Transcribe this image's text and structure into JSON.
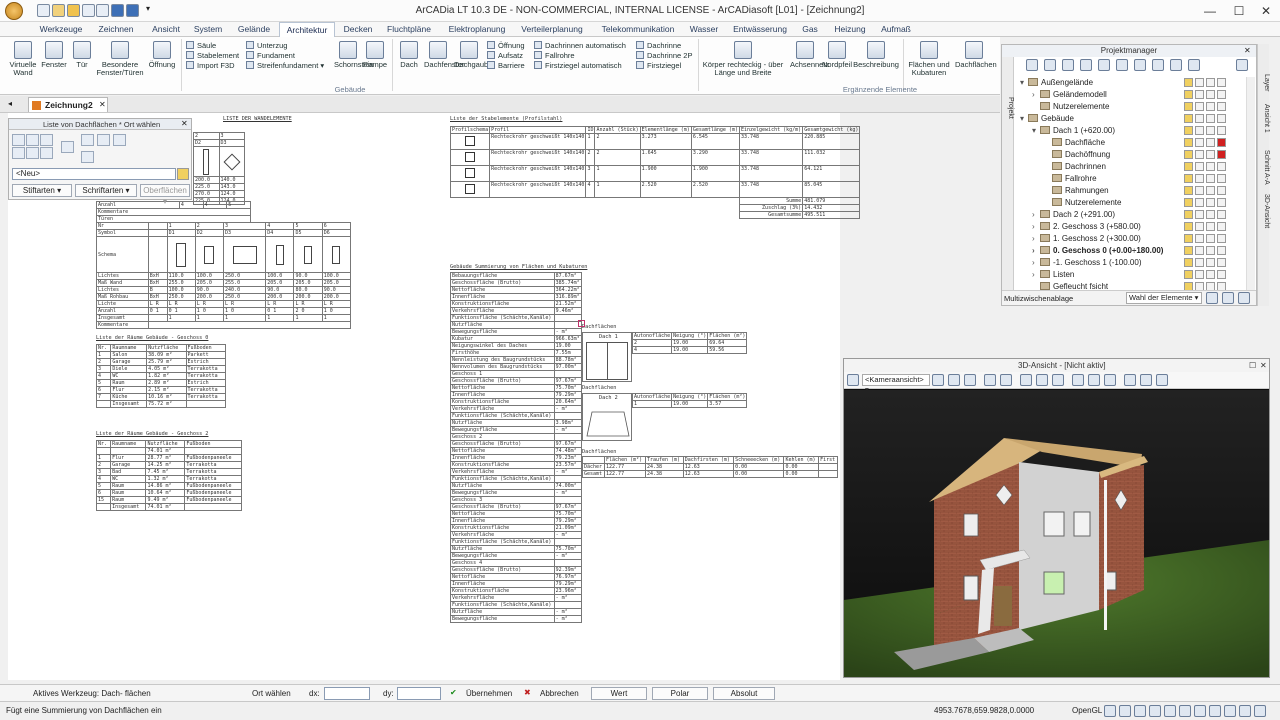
{
  "app": {
    "title": "ArCADia LT 10.3 DE - NON-COMMERCIAL, INTERNAL LICENSE - ArCADiasoft [L01] - [Zeichnung2]"
  },
  "menu": {
    "tabs": [
      "Werkzeuge",
      "Zeichnen",
      "Ansicht",
      "System",
      "Gelände",
      "Architektur",
      "Decken",
      "Fluchtpläne",
      "Elektroplanung",
      "Verteilerplanung",
      "Telekommunikation",
      "Wasser",
      "Entwässerung",
      "Gas",
      "Heizung",
      "Aufmaß"
    ],
    "active": "Architektur"
  },
  "ribbon": {
    "big1": [
      "Virtuelle Wand",
      "Fenster",
      "Tür",
      "Besondere Fenster/Türen",
      "Öffnung"
    ],
    "small1": [
      "Säule",
      "Stabelement",
      "Import F3D"
    ],
    "small2": [
      "Unterzug",
      "Fundament",
      "Streifenfundament"
    ],
    "big2": [
      "Schornstein",
      "Rampe",
      "Dach",
      "Dachfenster",
      "Dachgaube"
    ],
    "small3": [
      "Öffnung",
      "Aufsatz",
      "Barriere"
    ],
    "small4": [
      "Dachrinnen automatisch",
      "Fallrohre",
      "Firstziegel automatisch"
    ],
    "small5": [
      "Dachrinne",
      "Dachrinne 2P",
      "Firstziegel"
    ],
    "big3": [
      "Körper rechteckig - über Länge und Breite",
      "Achsennetz",
      "Nordpfeil",
      "Beschreibung",
      "Flächen und Kubaturen",
      "Dachflächen"
    ],
    "group_gebaeude": "Gebäude",
    "group_ergaenzende": "Ergänzende Elemente"
  },
  "doc": {
    "tab": "Zeichnung2"
  },
  "projektmanager": {
    "title": "Projektmanager",
    "side_left": "Projekt",
    "tree": [
      {
        "label": "Außengelände",
        "expand": "▾",
        "indent": 0
      },
      {
        "label": "Geländemodell",
        "expand": "›",
        "indent": 1
      },
      {
        "label": "Nutzerelemente",
        "expand": "",
        "indent": 1
      },
      {
        "label": "Gebäude",
        "expand": "▾",
        "indent": 0
      },
      {
        "label": "Dach 1 (+620.00)",
        "expand": "▾",
        "indent": 1
      },
      {
        "label": "Dachfläche",
        "expand": "",
        "indent": 2
      },
      {
        "label": "Dachöffnung",
        "expand": "",
        "indent": 2
      },
      {
        "label": "Dachrinnen",
        "expand": "",
        "indent": 2
      },
      {
        "label": "Fallrohre",
        "expand": "",
        "indent": 2
      },
      {
        "label": "Rahmungen",
        "expand": "",
        "indent": 2
      },
      {
        "label": "Nutzerelemente",
        "expand": "",
        "indent": 2
      },
      {
        "label": "Dach 2 (+291.00)",
        "expand": "›",
        "indent": 1
      },
      {
        "label": "2. Geschoss 3 (+580.00)",
        "expand": "›",
        "indent": 1
      },
      {
        "label": "1. Geschoss 2 (+300.00)",
        "expand": "›",
        "indent": 1
      },
      {
        "label": "0. Geschoss 0 (+0.00÷180.00)",
        "expand": "›",
        "indent": 1,
        "selected": true
      },
      {
        "label": "-1. Geschoss 1 (-100.00)",
        "expand": "›",
        "indent": 1
      },
      {
        "label": "Listen",
        "expand": "›",
        "indent": 1
      },
      {
        "label": "Gefleucht fsicht",
        "expand": "",
        "indent": 1
      }
    ],
    "footer_left": "Multizwischenablage",
    "footer_select": "Wahl der Elemente"
  },
  "sidetabs": [
    "Layer",
    "Ansicht 1",
    "Schnitt A-A",
    "3D-Ansicht"
  ],
  "dialog": {
    "title": "Liste von Dachflächen * Ort wählen",
    "value": "<Neu>",
    "btn1": "Stiftarten",
    "btn2": "Schriftarten",
    "btn3": "Oberflächen"
  },
  "drawing": {
    "title_wandelem": "LISTE DER WANDELEMENTE",
    "title_stabelem": "Liste der Stabelemente (Profilstahl)",
    "title_summ": "Gebäude Summierung von Flächen und Kubaturen",
    "title_raeume0": "Liste der Räume Gebäude - Geschoss 0",
    "title_raeume2": "Liste der Räume Gebäude - Geschoss 2",
    "stab_header": [
      "Profilschema",
      "Profil",
      "ID",
      "Anzahl (Stück)",
      "Elementlänge (m)",
      "Gesamtlänge (m)",
      "Einzelgewicht (kg/m)",
      "Gesamtgewicht (kg)"
    ],
    "stab_rows": [
      [
        "",
        "Rechteckrohr geschweißt 140x140",
        "1",
        "2",
        "3.273",
        "6.545",
        "33.748",
        "220.885"
      ],
      [
        "",
        "Rechteckrohr geschweißt 140x140",
        "2",
        "2",
        "1.645",
        "3.290",
        "33.748",
        "111.032"
      ],
      [
        "",
        "Rechteckrohr geschweißt 140x140",
        "3",
        "1",
        "1.900",
        "1.900",
        "33.748",
        "64.121"
      ],
      [
        "",
        "Rechteckrohr geschweißt 140x140",
        "4",
        "1",
        "2.520",
        "2.520",
        "33.748",
        "85.045"
      ]
    ],
    "stab_summe": [
      "Summe",
      "481.079"
    ],
    "stab_zuschlag": [
      "Zuschlag (3%)",
      "14.432"
    ],
    "stab_gesamt": [
      "Gesamtsumme",
      "495.511"
    ],
    "raeume0": [
      [
        "Nr.",
        "Raumname",
        "Nutzfläche",
        "Fußboden"
      ],
      [
        "1",
        "Salon",
        "38.09 m²",
        "Parkett"
      ],
      [
        "2",
        "Garage",
        "25.79 m²",
        "Estrich"
      ],
      [
        "3",
        "Diele",
        "4.05 m²",
        "Terrakotta"
      ],
      [
        "4",
        "WC",
        "1.82 m²",
        "Terrakotta"
      ],
      [
        "5",
        "Raum",
        "2.89 m²",
        "Estrich"
      ],
      [
        "6",
        "Flur",
        "2.15 m²",
        "Terrakotta"
      ],
      [
        "7",
        "Küche",
        "10.16 m²",
        "Terrakotta"
      ],
      [
        "",
        "Insgesamt",
        "75.72 m²",
        ""
      ]
    ],
    "raeume2": [
      [
        "Nr.",
        "Raumname",
        "Nutzfläche",
        "Fußboden"
      ],
      [
        "",
        "",
        "74.01 m²",
        ""
      ],
      [
        "1",
        "Flur",
        "28.77 m²",
        "Fußbodenpaneele"
      ],
      [
        "2",
        "Garage",
        "14.25 m²",
        "Terrakotta"
      ],
      [
        "3",
        "Bad",
        "7.45 m²",
        "Terrakotta"
      ],
      [
        "4",
        "WC",
        "1.32 m²",
        "Terrakotta"
      ],
      [
        "5",
        "Raum",
        "14.86 m²",
        "Fußbodenpaneele"
      ],
      [
        "6",
        "Raum",
        "10.64 m²",
        "Fußbodenpaneele"
      ],
      [
        "15",
        "Raum",
        "9.49 m²",
        "Fußbodenpaneele"
      ],
      [
        "",
        "Insgesamt",
        "74.01 m²",
        ""
      ]
    ],
    "summ_rows": [
      "Bebauungsfläche",
      "Geschossfläche (Brutto)",
      "Nettofläche",
      "Innenfläche",
      "Konstruktionsfläche",
      "Verkehrsfläche",
      "Funktionsfläche (Schächte,Kanäle)",
      "Nutzfläche",
      "Bewegungsfläche",
      "Kubatur",
      "Neigungswinkel des Daches",
      "Firsthöhe",
      "Nennleistung des Baugrundstücks",
      "Nennvolumen des Baugrundstücks",
      "Geschoss 1",
      "Geschossfläche (Brutto)",
      "Nettofläche",
      "Innenfläche",
      "Konstruktionsfläche",
      "Verkehrsfläche",
      "Funktionsfläche (Schächte,Kanäle)",
      "Nutzfläche",
      "Bewegungsfläche",
      "Geschoss 2",
      "Geschossfläche (Brutto)",
      "Nettofläche",
      "Innenfläche",
      "Konstruktionsfläche",
      "Verkehrsfläche",
      "Funktionsfläche (Schächte,Kanäle)",
      "Nutzfläche",
      "Bewegungsfläche",
      "Geschoss 3",
      "Geschossfläche (Brutto)",
      "Nettofläche",
      "Innenfläche",
      "Konstruktionsfläche",
      "Verkehrsfläche",
      "Funktionsfläche (Schächte,Kanäle)",
      "Nutzfläche",
      "Bewegungsfläche",
      "Geschoss 4",
      "Geschossfläche (Brutto)",
      "Nettofläche",
      "Innenfläche",
      "Konstruktionsfläche",
      "Verkehrsfläche",
      "Funktionsfläche (Schächte,Kanäle)",
      "Nutzfläche",
      "Bewegungsfläche"
    ],
    "summ_vals": [
      "87.67m²",
      "385.74m²",
      "364.22m²",
      "316.89m²",
      "21.52m²",
      "9.46m²",
      "",
      "",
      "- m²",
      "966.63m³",
      "19.00",
      "7.55m",
      "88.78m²",
      "97.00m³",
      "",
      "97.67m²",
      "75.70m²",
      "79.29m²",
      "20.64m²",
      "- m²",
      "",
      "3.98m²",
      "- m²",
      "",
      "97.67m²",
      "74.48m²",
      "79.23m²",
      "23.57m²",
      "- m²",
      "",
      "74.00m²",
      "- m²",
      "",
      "97.67m²",
      "75.70m²",
      "79.29m²",
      "21.09m²",
      "- m²",
      "",
      "75.70m²",
      "- m²",
      "",
      "92.39m²",
      "76.97m²",
      "79.29m²",
      "23.96m²",
      "- m²",
      "",
      "- m²",
      "- m²"
    ],
    "dach1_label": "Dach 1",
    "dach2_label": "Dach 2",
    "dachfl_label": "Dachflächen",
    "auto_header": [
      "Autonofläche",
      "Neigung (°)",
      "Flächen (m²)"
    ],
    "auto_rows": [
      [
        "2",
        "19.00",
        "69.64"
      ],
      [
        "4",
        "19.00",
        "59.56"
      ]
    ],
    "auto2_rows": [
      [
        "1",
        "19.00",
        "3.57"
      ]
    ],
    "dfl_header": [
      "",
      "Flächen (m²)",
      "Traufen (m)",
      "Dachfirsten (m)",
      "Schneeecken (m)",
      "Kehlen (m)",
      "First"
    ],
    "dfl_rows": [
      [
        "Dächer",
        "122.77",
        "24.38",
        "12.63",
        "0.00",
        "0.00",
        ""
      ],
      [
        "Gesamt",
        "122.77",
        "24.38",
        "12.63",
        "0.00",
        "0.00",
        ""
      ]
    ],
    "wand_header": [
      "Nr",
      "Symbol",
      "Schema",
      "Lichtes",
      "Maß Wand",
      "Lichtes",
      "Maß Rohbau",
      "Lichte",
      "Anzahl",
      "Insgesamt",
      "Kommentare"
    ],
    "wand_cols": [
      "1",
      "2",
      "3",
      "4",
      "5",
      "6"
    ],
    "wand_syms": [
      "D1",
      "D2",
      "D3",
      "D4",
      "D5",
      "D6"
    ]
  },
  "view3d": {
    "title": "3D-Ansicht - [Nicht aktiv]",
    "camera": "<Kameraansicht>"
  },
  "cmd": {
    "tool": "Aktives Werkzeug: Dach- flächen",
    "ort": "Ort wählen",
    "dx": "dx:",
    "dy": "dy:",
    "ok": "Übernehmen",
    "cancel": "Abbrechen",
    "wert": "Wert",
    "polar": "Polar",
    "absolut": "Absolut"
  },
  "status": {
    "msg": "Fügt eine Summierung von Dachflächen ein",
    "coords": "4953.7678,659.9828,0.0000",
    "renderer": "OpenGL"
  },
  "colors": {
    "ribbon_accent": "#2b579a",
    "roof": "#d4b27a",
    "brick": "#9a5540",
    "wall": "#cfcfcf",
    "grass": "#3d5e22"
  }
}
